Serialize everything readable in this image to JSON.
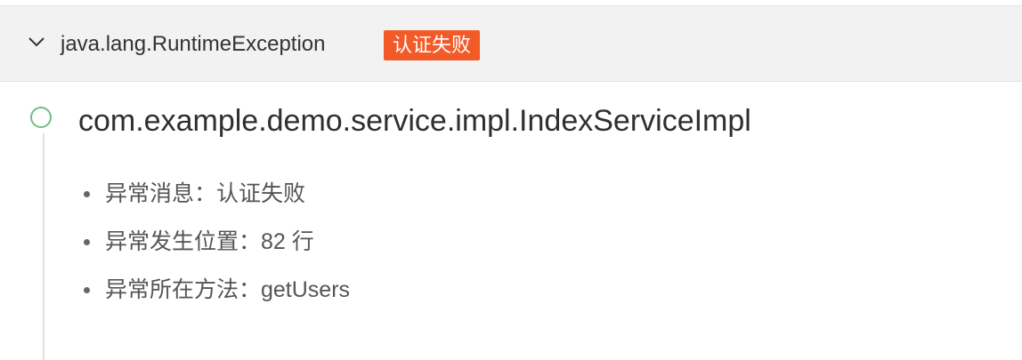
{
  "exception": {
    "type": "java.lang.RuntimeException",
    "badge": "认证失败",
    "badge_color": "#f25a28",
    "expand_icon": "chevron-down-icon"
  },
  "stack": {
    "class_name": "com.example.demo.service.impl.IndexServiceImpl",
    "node_color": "#6fbf85",
    "details": [
      {
        "text": "异常消息：认证失败"
      },
      {
        "text": "异常发生位置：82 行"
      },
      {
        "text": "异常所在方法：getUsers"
      }
    ]
  }
}
